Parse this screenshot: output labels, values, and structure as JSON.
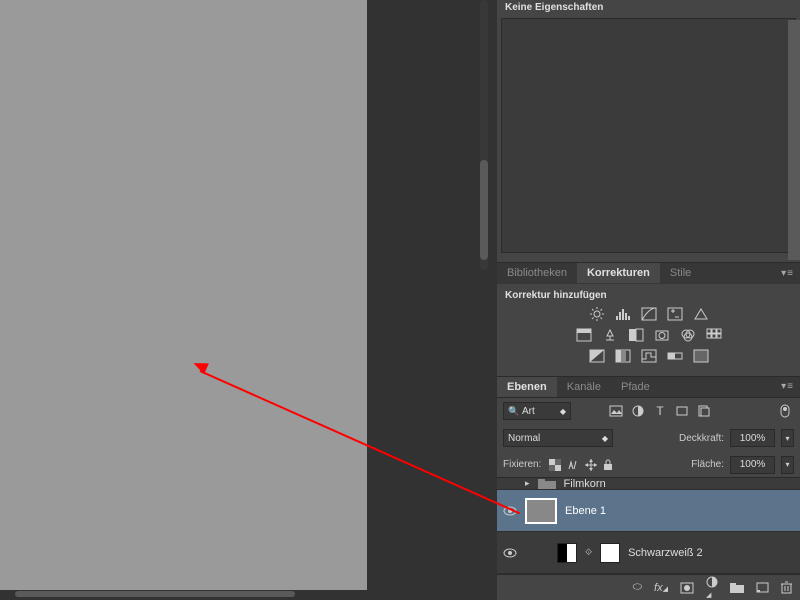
{
  "properties": {
    "title": "Keine Eigenschaften"
  },
  "adjust_tabs": {
    "lib": "Bibliotheken",
    "adj": "Korrekturen",
    "styles": "Stile"
  },
  "adjustments": {
    "add_label": "Korrektur hinzufügen"
  },
  "layer_tabs": {
    "layers": "Ebenen",
    "channels": "Kanäle",
    "paths": "Pfade"
  },
  "kind": {
    "prefix": "Art"
  },
  "blend": {
    "mode": "Normal",
    "opacity_label": "Deckkraft:",
    "opacity": "100%",
    "fill_label": "Fläche:",
    "fill": "100%"
  },
  "lock": {
    "label": "Fixieren:"
  },
  "layers": {
    "group": "Filmkorn",
    "l1": "Ebene 1",
    "l2": "Schwarzweiß 2"
  }
}
